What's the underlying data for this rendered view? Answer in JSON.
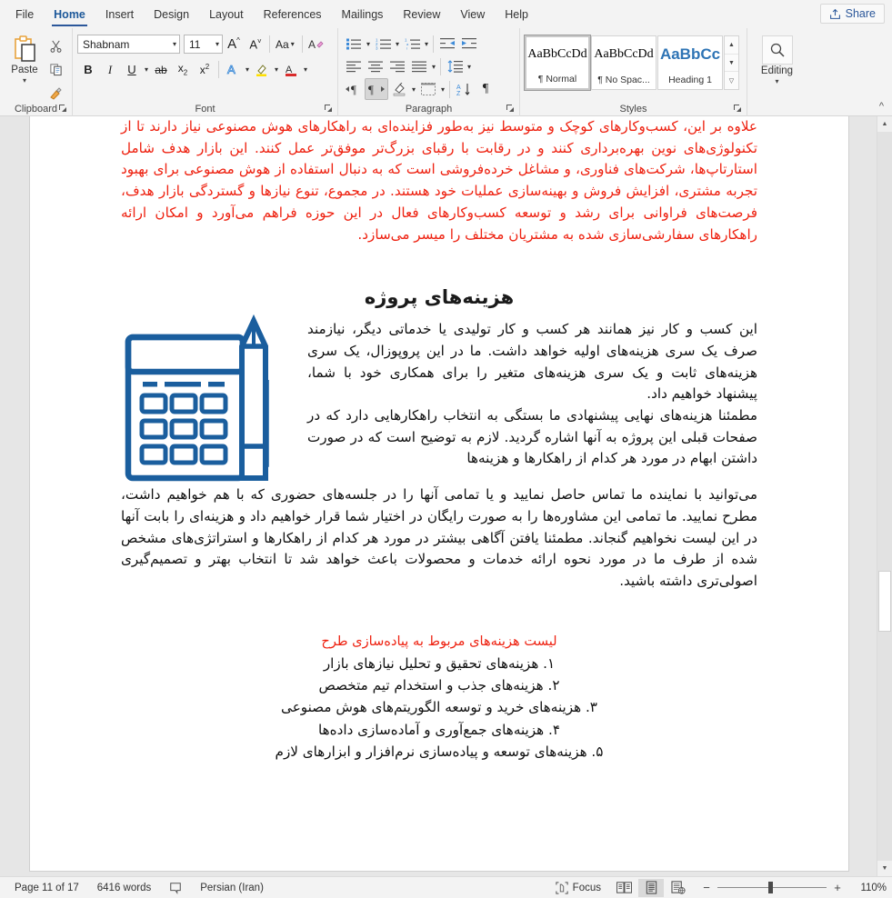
{
  "app": {
    "tabs": [
      {
        "id": "file",
        "label": "File",
        "active": false
      },
      {
        "id": "home",
        "label": "Home",
        "active": true
      },
      {
        "id": "insert",
        "label": "Insert",
        "active": false
      },
      {
        "id": "design",
        "label": "Design",
        "active": false
      },
      {
        "id": "layout",
        "label": "Layout",
        "active": false
      },
      {
        "id": "references",
        "label": "References",
        "active": false
      },
      {
        "id": "mailings",
        "label": "Mailings",
        "active": false
      },
      {
        "id": "review",
        "label": "Review",
        "active": false
      },
      {
        "id": "view",
        "label": "View",
        "active": false
      },
      {
        "id": "help",
        "label": "Help",
        "active": false
      }
    ],
    "share_label": "Share",
    "share_icon": "share-icon"
  },
  "ribbon": {
    "clipboard": {
      "group_label": "Clipboard",
      "paste_label": "Paste",
      "paste_icon": "paste-icon",
      "cut_icon": "scissors-icon",
      "copy_icon": "copy-icon",
      "format_painter_icon": "format-painter-icon",
      "launcher_icon": "dialog-launcher-icon"
    },
    "font": {
      "group_label": "Font",
      "font_name": "Shabnam",
      "font_size": "11",
      "grow_font_icon": "grow-font-icon",
      "shrink_font_icon": "shrink-font-icon",
      "change_case_icon": "change-case-icon",
      "clear_formatting_icon": "clear-formatting-icon",
      "bold_label": "B",
      "italic_label": "I",
      "underline_label": "U",
      "strikethrough_label": "ab",
      "subscript_label": "x",
      "subscript_sup": "2",
      "superscript_label": "x",
      "superscript_sup": "2",
      "text_effects_icon": "text-effects-icon",
      "highlight_icon": "text-highlight-icon",
      "font_color_icon": "font-color-icon",
      "launcher_icon": "dialog-launcher-icon"
    },
    "paragraph": {
      "group_label": "Paragraph",
      "bullets_icon": "bullets-icon",
      "numbering_icon": "numbering-icon",
      "multilevel_icon": "multilevel-list-icon",
      "decrease_indent_icon": "decrease-indent-icon",
      "increase_indent_icon": "increase-indent-icon",
      "align_left_icon": "align-left-icon",
      "align_center_icon": "align-center-icon",
      "align_right_icon": "align-right-icon",
      "justify_icon": "justify-icon",
      "line_spacing_icon": "line-spacing-icon",
      "ltr_icon": "left-to-right-icon",
      "rtl_icon": "right-to-left-icon",
      "rtl_active": true,
      "shading_icon": "shading-icon",
      "borders_icon": "borders-icon",
      "sort_icon": "sort-icon",
      "show_marks_icon": "show-formatting-marks-icon",
      "launcher_icon": "dialog-launcher-icon"
    },
    "styles": {
      "group_label": "Styles",
      "items": [
        {
          "preview": "AaBbCcDd",
          "name": "¶ Normal",
          "selected": true,
          "heading": false
        },
        {
          "preview": "AaBbCcDd",
          "name": "¶ No Spac...",
          "selected": false,
          "heading": false
        },
        {
          "preview": "AaBbCc",
          "name": "Heading 1",
          "selected": false,
          "heading": true
        }
      ],
      "scroll_up_icon": "scroll-up-icon",
      "scroll_down_icon": "scroll-down-icon",
      "more_styles_icon": "more-styles-icon",
      "launcher_icon": "dialog-launcher-icon"
    },
    "editing": {
      "group_label": "",
      "label": "Editing",
      "icon": "search-icon",
      "caret_icon": "chevron-down-icon"
    },
    "collapse_icon": "collapse-ribbon-icon"
  },
  "document": {
    "paragraph_red_1": "علاوه بر این، کسب‌وکارهای کوچک و متوسط نیز به‌طور فزاینده‌ای به راهکارهای هوش مصنوعی نیاز دارند تا از تکنولوژی‌های نوین بهره‌برداری کنند و در رقابت با رقبای بزرگ‌تر موفق‌تر عمل کنند. این بازار هدف شامل استارتاپ‌ها، شرکت‌های فناوری، و مشاغل خرده‌فروشی است که به دنبال استفاده از هوش مصنوعی برای بهبود تجربه مشتری، افزایش فروش و بهینه‌سازی عملیات خود هستند. در مجموع، تنوع نیازها و گستردگی بازار هدف، فرصت‌های فراوانی برای رشد و توسعه کسب‌وکارهای فعال در این حوزه فراهم می‌آورد و امکان ارائه راهکارهای سفارشی‌سازی شده به مشتریان مختلف را میسر می‌سازد.",
    "heading": "هزینه‌های پروژه",
    "paragraph_2": "این کسب و کار نیز همانند هر کسب و کار تولیدی یا خدماتی دیگر، نیازمند صرف یک سری هزینه‌های اولیه خواهد داشت. ما در این پروپوزال، یک سری هزینه‌های ثابت و یک سری هزینه‌های متغیر را برای همکاری خود با شما، پیشنهاد خواهیم داد.",
    "paragraph_3_col": "مطمئنا هزینه‌های نهایی پیشنهادی ما بستگی به انتخاب راهکارهایی دارد که در صفحات قبلی این پروژه به آنها اشاره گردید. لازم به توضیح است که در صورت داشتن ابهام در مورد هر کدام از راهکارها و هزینه‌ها",
    "paragraph_3_full": "می‌توانید با نماینده ما تماس حاصل نمایید و یا تمامی آنها را در جلسه‌های حضوری که با هم خواهیم داشت، مطرح نمایید. ما تمامی این مشاوره‌ها را به صورت رایگان در اختیار شما قرار خواهیم داد و هزینه‌ای را بابت آنها در این لیست نخواهیم گنجاند. مطمئنا یافتن آگاهی بیشتر در مورد هر کدام از راهکارها و استراتژی‌های مشخص شده از طرف ما در مورد نحوه ارائه خدمات و محصولات باعث خواهد شد تا انتخاب بهتر و تصمیم‌گیری اصولی‌تری داشته باشید.",
    "list_heading": "لیست هزینه‌های مربوط به پیاده‌سازی طرح",
    "list_items": [
      "۱. هزینه‌های تحقیق و تحلیل نیازهای بازار",
      "۲. هزینه‌های جذب و استخدام تیم متخصص",
      "۳. هزینه‌های خرید و توسعه الگوریتم‌های هوش مصنوعی",
      "۴. هزینه‌های جمع‌آوری و آماده‌سازی داده‌ها",
      "۵. هزینه‌های توسعه و پیاده‌سازی نرم‌افزار و ابزارهای لازم"
    ],
    "image_name": "calculator-and-pencil-illustration",
    "image_color": "#1a5e9e"
  },
  "scrollbar": {
    "up_icon": "scroll-up-arrow-icon",
    "down_icon": "scroll-down-arrow-icon",
    "thumb_name": "vertical-scroll-thumb"
  },
  "status": {
    "page_info": "Page 11 of 17",
    "word_count": "6416 words",
    "proofing_icon": "proofing-errors-icon",
    "language": "Persian (Iran)",
    "focus_label": "Focus",
    "focus_icon": "focus-mode-icon",
    "read_mode_icon": "read-mode-icon",
    "print_layout_icon": "print-layout-icon",
    "web_layout_icon": "web-layout-icon",
    "active_view": "print-layout",
    "zoom_out_label": "−",
    "zoom_in_label": "+",
    "zoom_level": "110%"
  },
  "colors": {
    "accent": "#2b579a",
    "red_text": "#ee2211",
    "illustration_blue": "#1a5e9e",
    "ribbon_bg": "#f3f3f3",
    "doc_bg": "#e6e6e6"
  }
}
